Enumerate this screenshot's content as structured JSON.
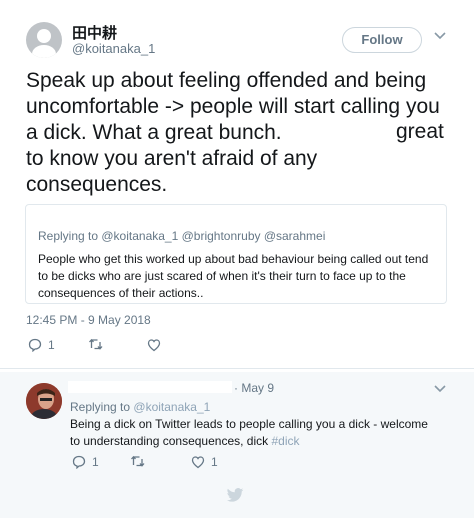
{
  "tweet": {
    "display_name": "田中耕",
    "handle": "@koitanaka_1",
    "follow_label": "Follow",
    "text_lines": [
      "Speak up about feeling offended and being",
      "uncomfortable -> people will start calling you",
      "a dick. What a great bunch.",
      "to know you aren't afraid of any",
      "consequences."
    ],
    "text_gap_word": "great",
    "quoted": {
      "replying_to": "Replying to @koitanaka_1 @brightonruby @sarahmei",
      "text": "People who get this worked up about bad behaviour being called out tend to be dicks who are just scared of when it's their turn to face up to the consequences of their actions.."
    },
    "timestamp": "12:45 PM - 9 May 2018",
    "actions": {
      "reply_count": "1",
      "retweet_count": "",
      "like_count": ""
    }
  },
  "reply": {
    "date": "· May 9",
    "replying_to_prefix": "Replying to",
    "replying_to_handle": "@koitanaka_1",
    "text": "Being a dick on Twitter leads to people calling you a dick - welcome to understanding consequences, dick",
    "hashtag": "#dick",
    "actions": {
      "reply_count": "1",
      "retweet_count": "",
      "like_count": "1"
    }
  },
  "colors": {
    "accent": "#1da1f2",
    "muted": "#657786",
    "border": "#e1e8ed"
  },
  "icons": [
    "chevron-down-icon",
    "reply-icon",
    "retweet-icon",
    "like-icon",
    "twitter-bird-icon"
  ]
}
